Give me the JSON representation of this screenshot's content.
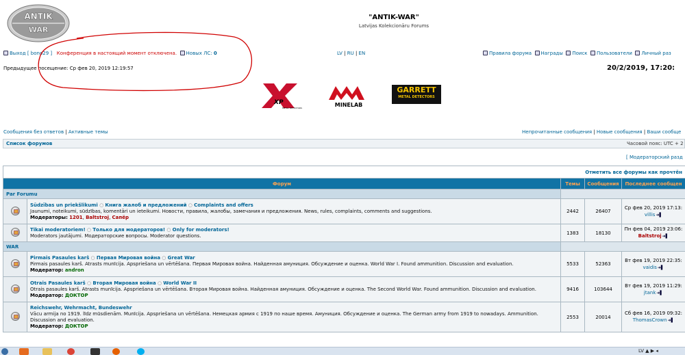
{
  "header": {
    "logo_top": "ANTIK",
    "logo_bottom": "WAR",
    "title": "\"ANTIK-WAR\"",
    "subtitle": "Latvijas Kolekcionāru Forums"
  },
  "topbar": {
    "logout": "Выход",
    "user": "[ bono29 ]",
    "conference_notice": "Конференция в настоящий момент отключена.",
    "new_pm": "Новых ЛС:",
    "new_pm_count": "0",
    "lang_lv": "LV",
    "lang_ru": "RU",
    "lang_en": "EN",
    "rules": "Правила форума",
    "awards": "Награды",
    "search": "Поиск",
    "users": "Пользователи",
    "personal": "Личный раз"
  },
  "last_visit": "Предыдущее посещение: Ср фев 20, 2019 12:19:57",
  "datetime": "20/2/2019, 17:20:",
  "sponsors": {
    "xp": "XP",
    "xp_small": "METAL DETECTORS",
    "minelab": "MINELAB",
    "garrett": "GARRETT",
    "garrett_small": "METAL DETECTORS"
  },
  "links_left": {
    "unanswered": "Сообщения без ответов",
    "active": "Активные темы"
  },
  "links_right": {
    "unread": "Непрочитанные сообщения",
    "new": "Новые сообщения",
    "yours": "Ваши сообще"
  },
  "navbar": {
    "crumb": "Список форумов",
    "timezone": "Часовой пояс: UTC + 2 ча"
  },
  "moderator_link": "[ Модераторский разд",
  "mark_all": "Отметить все форумы как прочтён",
  "columns": {
    "forum": "Форум",
    "topics": "Темы",
    "posts": "Сообщения",
    "last": "Последнее сообщен"
  },
  "categories": [
    {
      "name": "Par Forumu",
      "forums": [
        {
          "name": "Sūdzības un priekšlikumi",
          "name_ru": "Книга жалоб и предложений",
          "name_en": "Complaints and offers",
          "desc": "Jaunumi, noteikumi, sūdzības, komentāri un ieteikumi. Новости, правила, жалобы, замечания и предложения. News, rules, complaints, comments and suggestions.",
          "mods_label": "Модераторы:",
          "mods": [
            "1201",
            "Baltstroj",
            "Сапёр"
          ],
          "topics": "2442",
          "posts": "26407",
          "last_date": "Ср фев 20, 2019 17:13:",
          "last_author": "villis"
        },
        {
          "name": "Tikai moderatoriem!",
          "name_ru": "Только для модераторов!",
          "name_en": "Only for moderators!",
          "desc": "Moderators jautājumi. Модераторские вопросы. Moderator questions.",
          "mods_label": "",
          "mods": [],
          "topics": "1383",
          "posts": "18130",
          "last_date": "Пн фев 04, 2019 23:06:",
          "last_author": "Baltstroj"
        }
      ]
    },
    {
      "name": "WAR",
      "forums": [
        {
          "name": "Pirmais Pasaules karš",
          "name_ru": "Первая Мировая война",
          "name_en": "Great War",
          "desc": "Pirmais pasaules karš. Atrasts munīcija. Apspriešana un vērtēšana. Первая Мировая война. Найденная амуниция. Обсуждение и оценка. World War I. Found ammunition. Discussion and evaluation.",
          "mods_label": "Модератор:",
          "mods": [
            "andron"
          ],
          "topics": "5533",
          "posts": "52363",
          "last_date": "Вт фев 19, 2019 22:35:",
          "last_author": "vaidis"
        },
        {
          "name": "Otrais Pasaules karš",
          "name_ru": "Вторая Мировая война",
          "name_en": "World War II",
          "desc": "Otrais pasaules karš. Atrasts munīcija. Apspriešana un vērtēšana. Вторая Мировая война. Найденная амуниция. Обсуждение и оценка. The Second World War. Found ammunition. Discussion and evaluation.",
          "mods_label": "Модератор:",
          "mods": [
            "ДОКТОР"
          ],
          "topics": "9416",
          "posts": "103644",
          "last_date": "Вт фев 19, 2019 11:29:",
          "last_author": "jtank"
        },
        {
          "name": "Reichswehr, Wehrmacht, Bundeswehr",
          "name_ru": "",
          "name_en": "",
          "desc": "Vācu armija no 1919. līdz mūsdienām. Munīcija. Apspriešana un vērtēšana. Немецкая армия с 1919 по наше время. Амуниция. Обсуждение и оценка. The German army from 1919 to nowadays. Ammunition. Discussion and evaluation.",
          "mods_label": "Модератор:",
          "mods": [
            "ДОКТОР"
          ],
          "topics": "2553",
          "posts": "20014",
          "last_date": "Сб фев 16, 2019 09:32:",
          "last_author": "ThomasCrown"
        }
      ]
    }
  ],
  "taskbar": {
    "tray": "LV"
  },
  "colors": {
    "header_bg": "#1173a5",
    "header_text": "#ffa34f",
    "link": "#006597",
    "annotation": "#d00000"
  }
}
